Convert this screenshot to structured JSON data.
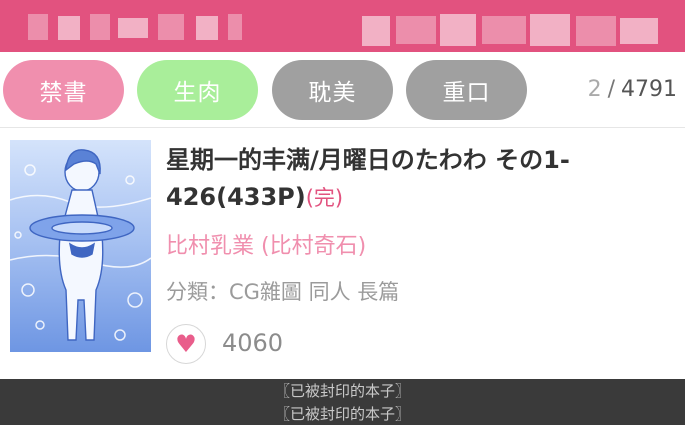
{
  "filters": {
    "tab1": "禁書",
    "tab2": "生肉",
    "tab3": "耽美",
    "tab4": "重口"
  },
  "pager": {
    "current": "2",
    "separator": "/",
    "total": "4791"
  },
  "item": {
    "title": "星期一的丰满/月曜日のたわわ その1-426(433P)",
    "status": "(完)",
    "author": "比村乳業 (比村奇石)",
    "categories": "分類：CG雜圖 同人 長篇",
    "likes": "4060",
    "heart_icon": "heart-icon"
  },
  "bottom": {
    "notice_1": "〖已被封印的本子〗",
    "notice_2": "〖已被封印的本子〗"
  },
  "colors": {
    "accent": "#e2527f",
    "pink": "#f08fae",
    "green": "#a9ee9a",
    "gray": "#a0a0a0"
  }
}
